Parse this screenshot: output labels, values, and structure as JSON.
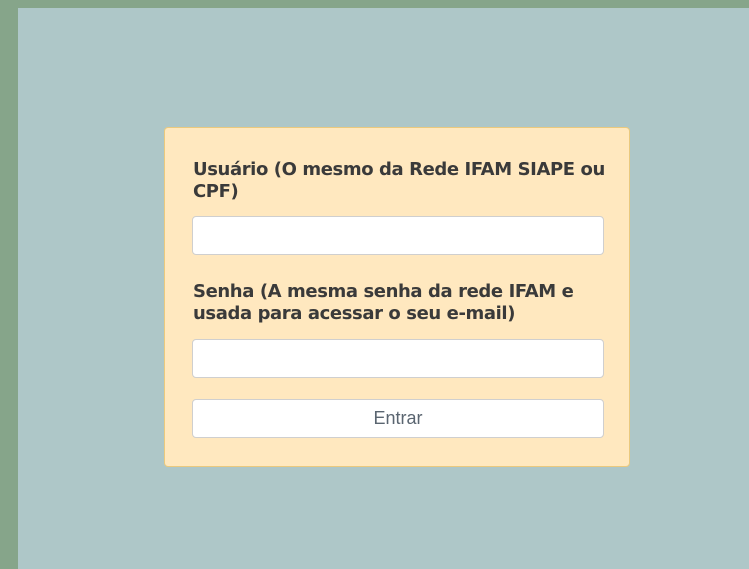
{
  "login_form": {
    "user_label": "Usuário (O mesmo da Rede IFAM SIAPE ou CPF)",
    "user_value": "",
    "password_label": "Senha (A mesma senha da rede IFAM e usada para acessar o seu e-mail)",
    "password_value": "",
    "submit_label": "Entrar"
  },
  "colors": {
    "outer_background": "#86a58a",
    "page_background": "#aec7c8",
    "form_background": "#ffe8bf",
    "form_border": "#eac97e"
  }
}
